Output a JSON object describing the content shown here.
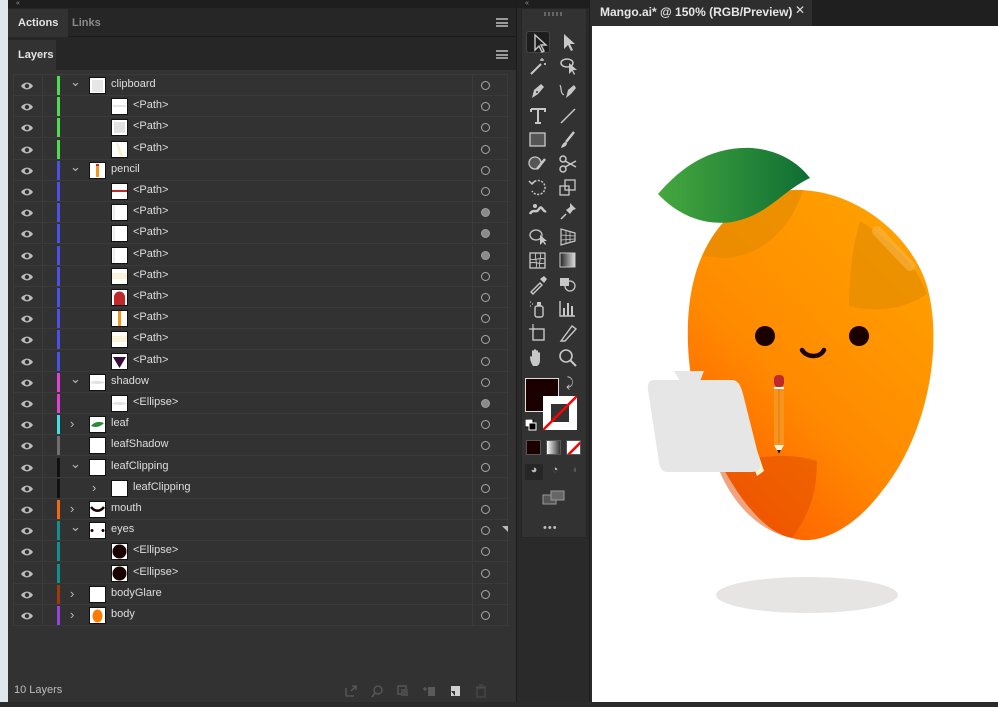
{
  "panel_top": {
    "tabs": [
      {
        "label": "Actions",
        "active": true
      },
      {
        "label": "Links",
        "active": false
      }
    ],
    "menu_icon": "hamburger-menu-icon"
  },
  "layers_panel": {
    "title": "Layers",
    "menu_icon": "hamburger-menu-icon",
    "rows": [
      {
        "name": "clipboard",
        "level": 0,
        "expander": "expanded",
        "color": "#4fdc4f",
        "thumb": "clipboard",
        "target": "empty"
      },
      {
        "name": "<Path>",
        "level": 1,
        "expander": "none",
        "color": "#4fdc4f",
        "thumb": "path-lines",
        "target": "empty"
      },
      {
        "name": "<Path>",
        "level": 1,
        "expander": "none",
        "color": "#4fdc4f",
        "thumb": "path-gray",
        "target": "empty"
      },
      {
        "name": "<Path>",
        "level": 1,
        "expander": "none",
        "color": "#4fdc4f",
        "thumb": "path-yellow",
        "target": "empty"
      },
      {
        "name": "pencil",
        "level": 0,
        "expander": "expanded",
        "color": "#4a50e8",
        "thumb": "pencil",
        "target": "empty"
      },
      {
        "name": "<Path>",
        "level": 1,
        "expander": "none",
        "color": "#4a50e8",
        "thumb": "path-redline",
        "target": "empty"
      },
      {
        "name": "<Path>",
        "level": 1,
        "expander": "none",
        "color": "#4a50e8",
        "thumb": "path-white",
        "target": "filled"
      },
      {
        "name": "<Path>",
        "level": 1,
        "expander": "none",
        "color": "#4a50e8",
        "thumb": "path-white",
        "target": "filled"
      },
      {
        "name": "<Path>",
        "level": 1,
        "expander": "none",
        "color": "#4a50e8",
        "thumb": "path-white",
        "target": "filled"
      },
      {
        "name": "<Path>",
        "level": 1,
        "expander": "none",
        "color": "#4a50e8",
        "thumb": "path-cream",
        "target": "empty"
      },
      {
        "name": "<Path>",
        "level": 1,
        "expander": "none",
        "color": "#4a50e8",
        "thumb": "path-eraser",
        "target": "empty"
      },
      {
        "name": "<Path>",
        "level": 1,
        "expander": "none",
        "color": "#4a50e8",
        "thumb": "path-orangeline",
        "target": "empty"
      },
      {
        "name": "<Path>",
        "level": 1,
        "expander": "none",
        "color": "#4a50e8",
        "thumb": "path-cream",
        "target": "empty"
      },
      {
        "name": "<Path>",
        "level": 1,
        "expander": "none",
        "color": "#4a50e8",
        "thumb": "path-tip",
        "target": "empty"
      },
      {
        "name": "shadow",
        "level": 0,
        "expander": "expanded",
        "color": "#e040d8",
        "thumb": "shadow",
        "target": "empty"
      },
      {
        "name": "<Ellipse>",
        "level": 1,
        "expander": "none",
        "color": "#e040d8",
        "thumb": "shadow",
        "target": "filled"
      },
      {
        "name": "leaf",
        "level": 0,
        "expander": "collapsed",
        "color": "#40e0e8",
        "thumb": "leaf",
        "target": "empty"
      },
      {
        "name": "leafShadow",
        "level": 0,
        "expander": "none",
        "color": "#707070",
        "thumb": "blank",
        "target": "empty"
      },
      {
        "name": "leafClipping",
        "level": 0,
        "expander": "expanded",
        "color": "#111111",
        "thumb": "blank",
        "target": "empty"
      },
      {
        "name": "leafClipping",
        "level": 1,
        "expander": "collapsed",
        "color": "#111111",
        "thumb": "blank",
        "target": "empty"
      },
      {
        "name": "mouth",
        "level": 0,
        "expander": "collapsed",
        "color": "#f06a10",
        "thumb": "mouth",
        "target": "empty"
      },
      {
        "name": "eyes",
        "level": 0,
        "expander": "expanded",
        "color": "#109090",
        "thumb": "eyes",
        "target": "empty"
      },
      {
        "name": "<Ellipse>",
        "level": 1,
        "expander": "none",
        "color": "#109090",
        "thumb": "eye",
        "target": "empty"
      },
      {
        "name": "<Ellipse>",
        "level": 1,
        "expander": "none",
        "color": "#109090",
        "thumb": "eye",
        "target": "empty"
      },
      {
        "name": "bodyGlare",
        "level": 0,
        "expander": "collapsed",
        "color": "#a03a0a",
        "thumb": "blank",
        "target": "empty"
      },
      {
        "name": "body",
        "level": 0,
        "expander": "collapsed",
        "color": "#9a40e0",
        "thumb": "body",
        "target": "empty"
      }
    ],
    "footer": {
      "count_label": "10 Layers",
      "buttons": [
        {
          "icon": "export-icon",
          "label": "Collect for Export"
        },
        {
          "icon": "locate-object-icon",
          "label": "Locate Object"
        },
        {
          "icon": "clipping-mask-icon",
          "label": "Make Clipping Mask"
        },
        {
          "icon": "new-sublayer-icon",
          "label": "Create New Sublayer"
        },
        {
          "icon": "new-layer-icon",
          "label": "Create New Layer"
        },
        {
          "icon": "trash-icon",
          "label": "Delete Selection"
        }
      ]
    }
  },
  "toolbar": {
    "tools": [
      "selection-tool-icon",
      "direct-selection-tool-icon",
      "magic-wand-tool-icon",
      "lasso-tool-icon",
      "pen-tool-icon",
      "curvature-tool-icon",
      "type-tool-icon",
      "line-tool-icon",
      "rectangle-tool-icon",
      "paintbrush-tool-icon",
      "shaper-tool-icon",
      "scissors-tool-icon",
      "rotate-tool-icon",
      "scale-tool-icon",
      "puppet-warp-tool-icon",
      "pin-tool-icon",
      "free-transform-tool-icon",
      "perspective-grid-tool-icon",
      "mesh-tool-icon",
      "gradient-tool-icon",
      "eyedropper-tool-icon",
      "shape-builder-tool-icon",
      "symbol-sprayer-tool-icon",
      "graph-tool-icon",
      "artboard-tool-icon",
      "slice-tool-icon",
      "hand-tool-icon",
      "zoom-tool-icon"
    ],
    "fill_color": "#1c0000",
    "stroke": "none",
    "more_label": "•••"
  },
  "document": {
    "tab_title": "Mango.ai* @ 150% (RGB/Preview)",
    "close_glyph": "✕"
  }
}
